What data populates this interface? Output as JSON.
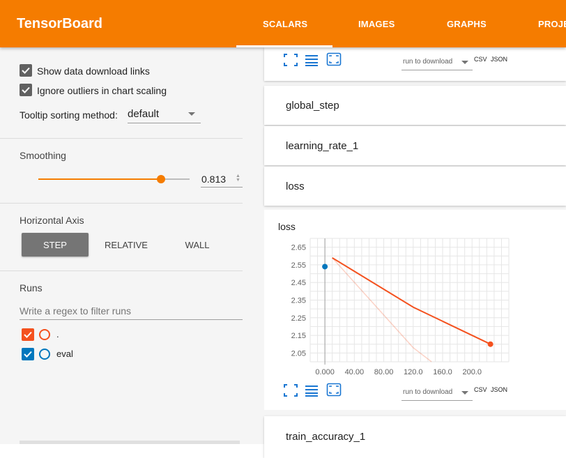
{
  "header": {
    "brand": "TensorBoard",
    "tabs": [
      "SCALARS",
      "IMAGES",
      "GRAPHS",
      "PROJE"
    ],
    "active_tab": "SCALARS",
    "bar_color": "#f57c00"
  },
  "sidebar": {
    "show_download_links": {
      "label": "Show data download links",
      "checked": true
    },
    "ignore_outliers": {
      "label": "Ignore outliers in chart scaling",
      "checked": true
    },
    "tooltip_sorting": {
      "label": "Tooltip sorting method:",
      "value": "default"
    },
    "smoothing": {
      "title": "Smoothing",
      "value": "0.813",
      "fraction": 0.813
    },
    "horizontal_axis": {
      "title": "Horizontal Axis",
      "options": [
        "STEP",
        "RELATIVE",
        "WALL"
      ],
      "selected": "STEP"
    },
    "runs": {
      "title": "Runs",
      "filter_placeholder": "Write a regex to filter runs",
      "items": [
        {
          "name": ".",
          "color": "#f4511e",
          "checked": true
        },
        {
          "name": "eval",
          "color": "#0277bd",
          "checked": true
        }
      ]
    }
  },
  "main": {
    "download": {
      "placeholder": "run to download",
      "csv": "CSV",
      "json": "JSON"
    },
    "groups": [
      "global_step",
      "learning_rate_1",
      "loss",
      "train_accuracy_1"
    ]
  },
  "chart_data": {
    "type": "line",
    "title": "loss",
    "xlabel": "",
    "ylabel": "",
    "xlim": [
      -20,
      250
    ],
    "ylim": [
      2.0,
      2.7
    ],
    "x_ticks": [
      "0.000",
      "40.00",
      "80.00",
      "120.0",
      "160.0",
      "200.0"
    ],
    "y_ticks": [
      "2.65",
      "2.55",
      "2.45",
      "2.35",
      "2.25",
      "2.15",
      "2.05"
    ],
    "grid": true,
    "series": [
      {
        "name": ".",
        "color": "#f4511e",
        "x": [
          10,
          120,
          225
        ],
        "y": [
          2.59,
          2.31,
          2.1
        ]
      },
      {
        "name": ".",
        "color": "#f4511e",
        "raw": true,
        "x": [
          10,
          120,
          145
        ],
        "y": [
          2.59,
          2.08,
          2.0
        ]
      },
      {
        "name": "eval",
        "color": "#0277bd",
        "x": [
          0
        ],
        "y": [
          2.54
        ]
      }
    ]
  }
}
